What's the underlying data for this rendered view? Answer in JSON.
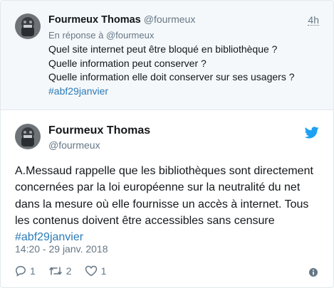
{
  "parent_tweet": {
    "author_name": "Fourmeux Thomas",
    "author_handle": "@fourmeux",
    "time": "4h",
    "reply_to": "En réponse à @fourmeux",
    "lines": [
      "Quel site internet peut être bloqué en bibliothèque ?",
      "Quelle information peut conserver ?",
      "Quelle information elle doit conserver sur ses usagers ?"
    ],
    "hashtag": "#abf29janvier"
  },
  "main_tweet": {
    "author_name": "Fourmeux Thomas",
    "author_handle": "@fourmeux",
    "lines": [
      "A.Messaud rappelle que les bibliothèques sont directement",
      "concernées par la loi européenne sur la neutralité du net",
      "dans la mesure où elle fournisse un accès à internet. Tous",
      "les contenus doivent être accessibles sans censure"
    ],
    "hashtag": "#abf29janvier",
    "timestamp": "14:20 - 29 janv. 2018",
    "reply_count": "1",
    "retweet_count": "2",
    "like_count": "1"
  },
  "colors": {
    "link": "#2b7bb9",
    "twitter_blue": "#1da1f2",
    "muted": "#657786",
    "parent_bg": "#f5f8fa"
  },
  "icons": [
    "twitter-bird-icon",
    "reply-icon",
    "retweet-icon",
    "like-icon",
    "info-icon"
  ]
}
